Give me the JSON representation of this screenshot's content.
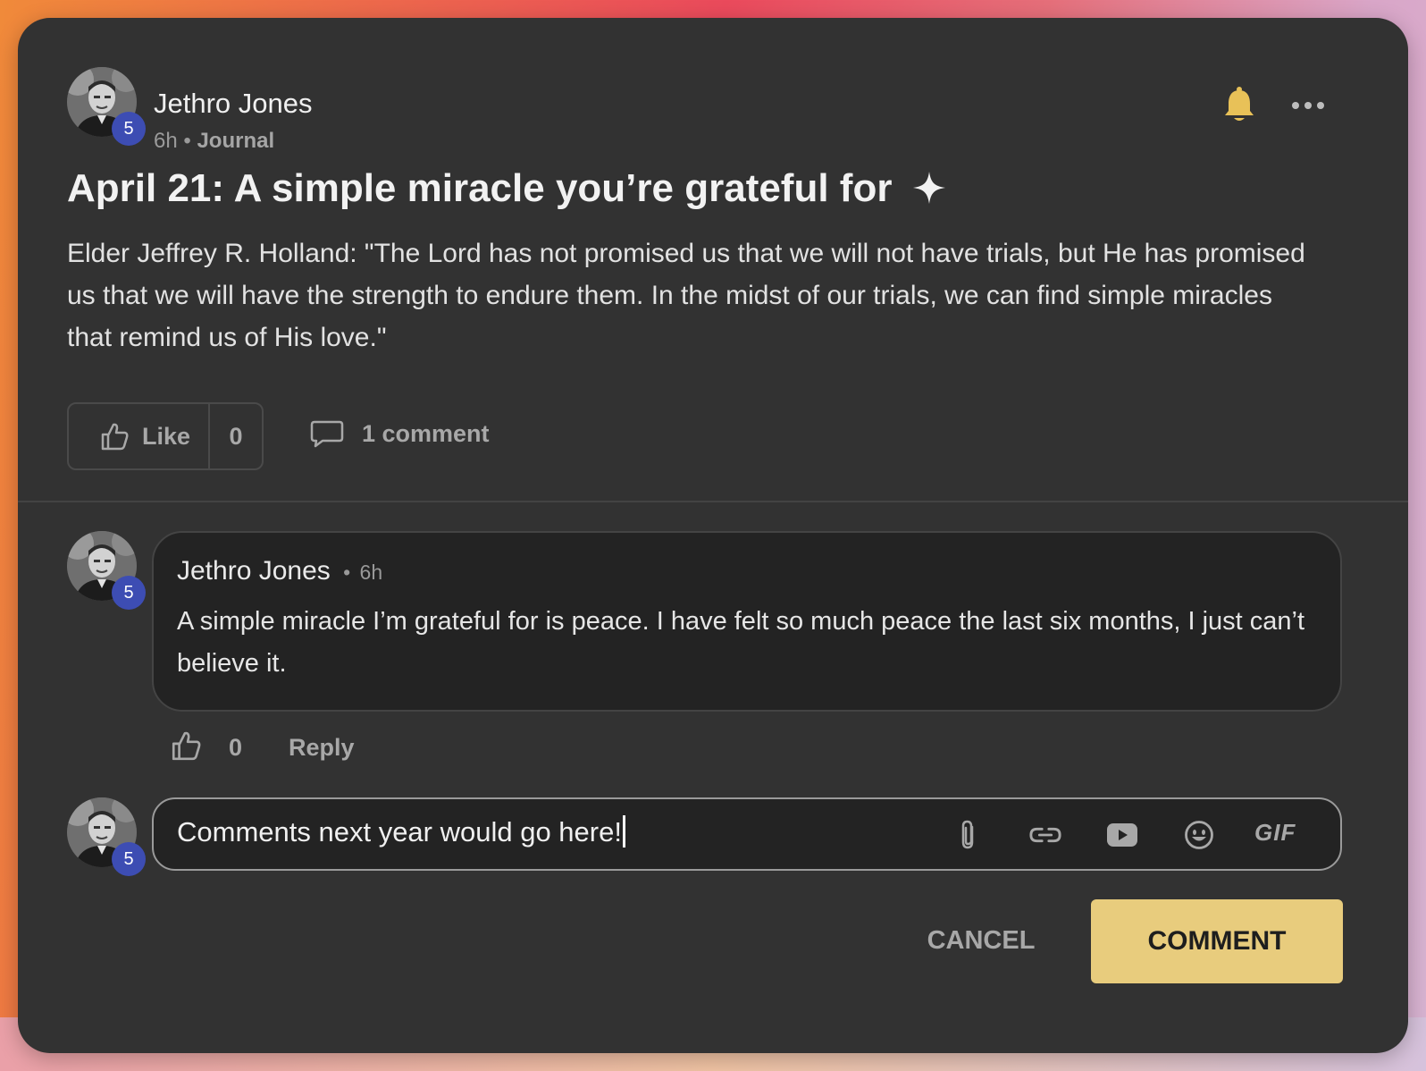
{
  "post": {
    "author": "Jethro Jones",
    "author_level": "5",
    "time": "6h",
    "separator": "•",
    "category": "Journal",
    "title": "April 21: A simple miracle you’re grateful for",
    "title_icon": "sparkle-icon",
    "body": "Elder Jeffrey R. Holland: \"The Lord has not promised us that we will not have trials, but He has promised us that we will have the strength to endure them. In the midst of our trials, we can find simple miracles that remind us of His love.\"",
    "like_label": "Like",
    "like_count": "0",
    "comment_count_label": "1 comment",
    "bell_color": "#e8c158"
  },
  "comments": [
    {
      "author": "Jethro Jones",
      "author_level": "5",
      "separator": "•",
      "time": "6h",
      "text": "A simple miracle I’m grateful for is peace. I have felt so much peace the last six months, I just can’t believe it.",
      "like_count": "0",
      "reply_label": "Reply"
    }
  ],
  "composer": {
    "author_level": "5",
    "value": "Comments next year would go here!",
    "tools": [
      "paperclip-icon",
      "link-icon",
      "youtube-icon",
      "emoji-icon"
    ],
    "gif_label": "GIF",
    "cancel_label": "CANCEL",
    "submit_label": "COMMENT",
    "submit_color": "#e8cc7d"
  },
  "colors": {
    "card_bg": "#323232",
    "badge_bg": "#3d4db3",
    "bubble_bg": "#232323"
  }
}
